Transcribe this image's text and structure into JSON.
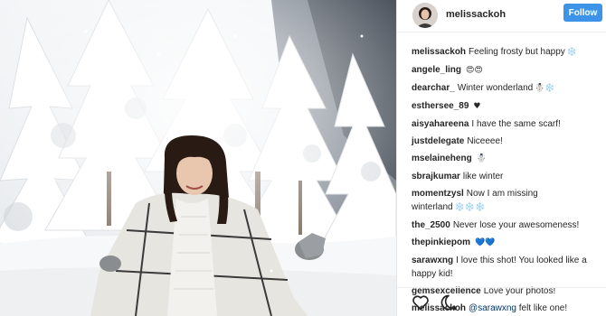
{
  "post": {
    "username": "melissackoh",
    "follow_label": "Follow"
  },
  "comments": [
    {
      "user": "melissackoh",
      "text": "Feeling frosty but happy",
      "emoji": "❄️"
    },
    {
      "user": "angele_ling",
      "text": "",
      "emoji": "😍😍"
    },
    {
      "user": "dearchar_",
      "text": "Winter wonderland",
      "emoji": "☃️❄️"
    },
    {
      "user": "esthersee_89",
      "text": "",
      "emoji": "♥"
    },
    {
      "user": "aisyahareena",
      "text": "I have the same scarf!",
      "emoji": ""
    },
    {
      "user": "justdelegate",
      "text": "Niceeee!",
      "emoji": ""
    },
    {
      "user": "mselaineheng",
      "text": "",
      "emoji": "☃️"
    },
    {
      "user": "sbrajkumar",
      "text": "like winter",
      "emoji": ""
    },
    {
      "user": "momentzysl",
      "text": "Now I am missing winterland",
      "emoji": "❄️❄️❄️"
    },
    {
      "user": "the_2500",
      "text": "Never lose your awesomeness!",
      "emoji": ""
    },
    {
      "user": "thepinkiepom",
      "text": "",
      "emoji": "💙💙"
    },
    {
      "user": "sarawxng",
      "text": "I love this shot! You looked like a happy kid!",
      "emoji": ""
    },
    {
      "user": "gemsexcellence",
      "text": "Love your photos!",
      "emoji": ""
    },
    {
      "user": "melissackoh",
      "mention": "@sarawxng",
      "text": "felt like one!",
      "emoji": ""
    }
  ],
  "actions": {
    "like_icon": "heart-outline-icon",
    "comment_icon": "speech-bubble-icon"
  },
  "colors": {
    "follow_button": "#3d93e8",
    "mention_link": "#003569",
    "heart_emoji": "#e0245e"
  }
}
